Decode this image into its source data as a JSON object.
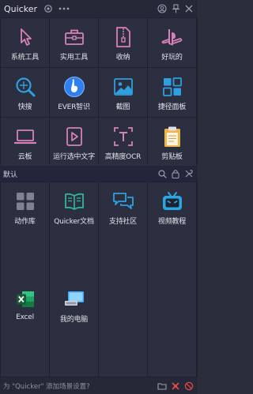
{
  "app": {
    "title": "Quicker"
  },
  "top_grid": [
    {
      "label": "系统工具",
      "icon": "cursor-arrow-icon"
    },
    {
      "label": "实用工具",
      "icon": "toolbox-icon"
    },
    {
      "label": "收纳",
      "icon": "zip-file-icon"
    },
    {
      "label": "好玩的",
      "icon": "playstation-icon"
    },
    {
      "label": "快搜",
      "icon": "search-globe-icon"
    },
    {
      "label": "EVER智识",
      "icon": "ever-logo-icon"
    },
    {
      "label": "截图",
      "icon": "image-icon"
    },
    {
      "label": "捷径面板",
      "icon": "dashboard-grid-icon"
    },
    {
      "label": "云板",
      "icon": "laptop-icon"
    },
    {
      "label": "运行选中文字",
      "icon": "play-doc-icon"
    },
    {
      "label": "高精度OCR",
      "icon": "ocr-text-icon"
    },
    {
      "label": "剪贴板",
      "icon": "clipboard-icon"
    }
  ],
  "scene": {
    "title": "默认"
  },
  "bottom_grid": [
    {
      "label": "动作库",
      "icon": "apps-grid-icon"
    },
    {
      "label": "Quicker文档",
      "icon": "book-icon"
    },
    {
      "label": "支持社区",
      "icon": "chat-bubbles-icon"
    },
    {
      "label": "视频教程",
      "icon": "bilibili-tv-icon"
    },
    {
      "label": "",
      "icon": ""
    },
    {
      "label": "",
      "icon": ""
    },
    {
      "label": "",
      "icon": ""
    },
    {
      "label": "",
      "icon": ""
    },
    {
      "label": "Excel",
      "icon": "excel-icon"
    },
    {
      "label": "我的电脑",
      "icon": "computer-icon"
    },
    {
      "label": "",
      "icon": ""
    },
    {
      "label": "",
      "icon": ""
    },
    {
      "label": "",
      "icon": ""
    },
    {
      "label": "",
      "icon": ""
    },
    {
      "label": "",
      "icon": ""
    },
    {
      "label": "",
      "icon": ""
    }
  ],
  "status": {
    "text": "为 \"Quicker\" 添加场景设置?"
  },
  "colors": {
    "accent_blue": "#2f9fe0",
    "excel_green": "#1d7a45",
    "bilibili_blue": "#2aa6e0",
    "pink": "#d65fa0"
  }
}
